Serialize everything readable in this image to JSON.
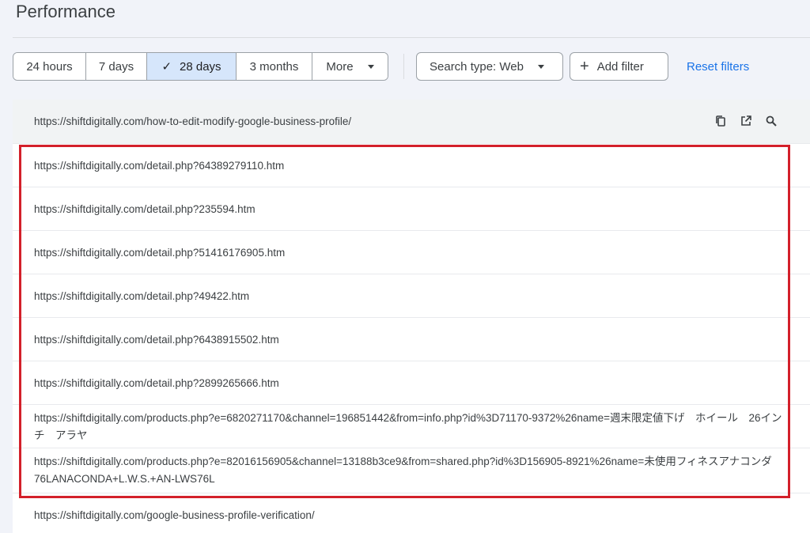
{
  "page": {
    "title": "Performance"
  },
  "date_range": {
    "options": [
      "24 hours",
      "7 days",
      "28 days",
      "3 months",
      "More"
    ],
    "selected": "28 days"
  },
  "filters": {
    "search_type_label": "Search type: Web",
    "add_filter_label": "Add filter",
    "reset_label": "Reset filters"
  },
  "icons": {
    "copy": "copy-icon",
    "open": "open-in-new-icon",
    "inspect": "search-icon",
    "check": "check-icon",
    "dropdown": "caret-down-icon",
    "plus": "plus-icon"
  },
  "colors": {
    "accent": "#1a73e8",
    "selected_bg": "#d6e6fb",
    "highlight": "#d3202a"
  },
  "table": {
    "header_url": "https://shiftdigitally.com/how-to-edit-modify-google-business-profile/",
    "rows": [
      "https://shiftdigitally.com/detail.php?64389279110.htm",
      "https://shiftdigitally.com/detail.php?235594.htm",
      "https://shiftdigitally.com/detail.php?51416176905.htm",
      "https://shiftdigitally.com/detail.php?49422.htm",
      "https://shiftdigitally.com/detail.php?6438915502.htm",
      "https://shiftdigitally.com/detail.php?2899265666.htm",
      "https://shiftdigitally.com/products.php?e=6820271170&channel=196851442&from=info.php?id%3D71170-9372%26name=週末限定値下げ　ホイール　26インチ　アラヤ",
      "https://shiftdigitally.com/products.php?e=82016156905&channel=13188b3ce9&from=shared.php?id%3D156905-8921%26name=未使用フィネスアナコンダ76LANACONDA+L.W.S.+AN-LWS76L",
      "https://shiftdigitally.com/google-business-profile-verification/"
    ]
  }
}
